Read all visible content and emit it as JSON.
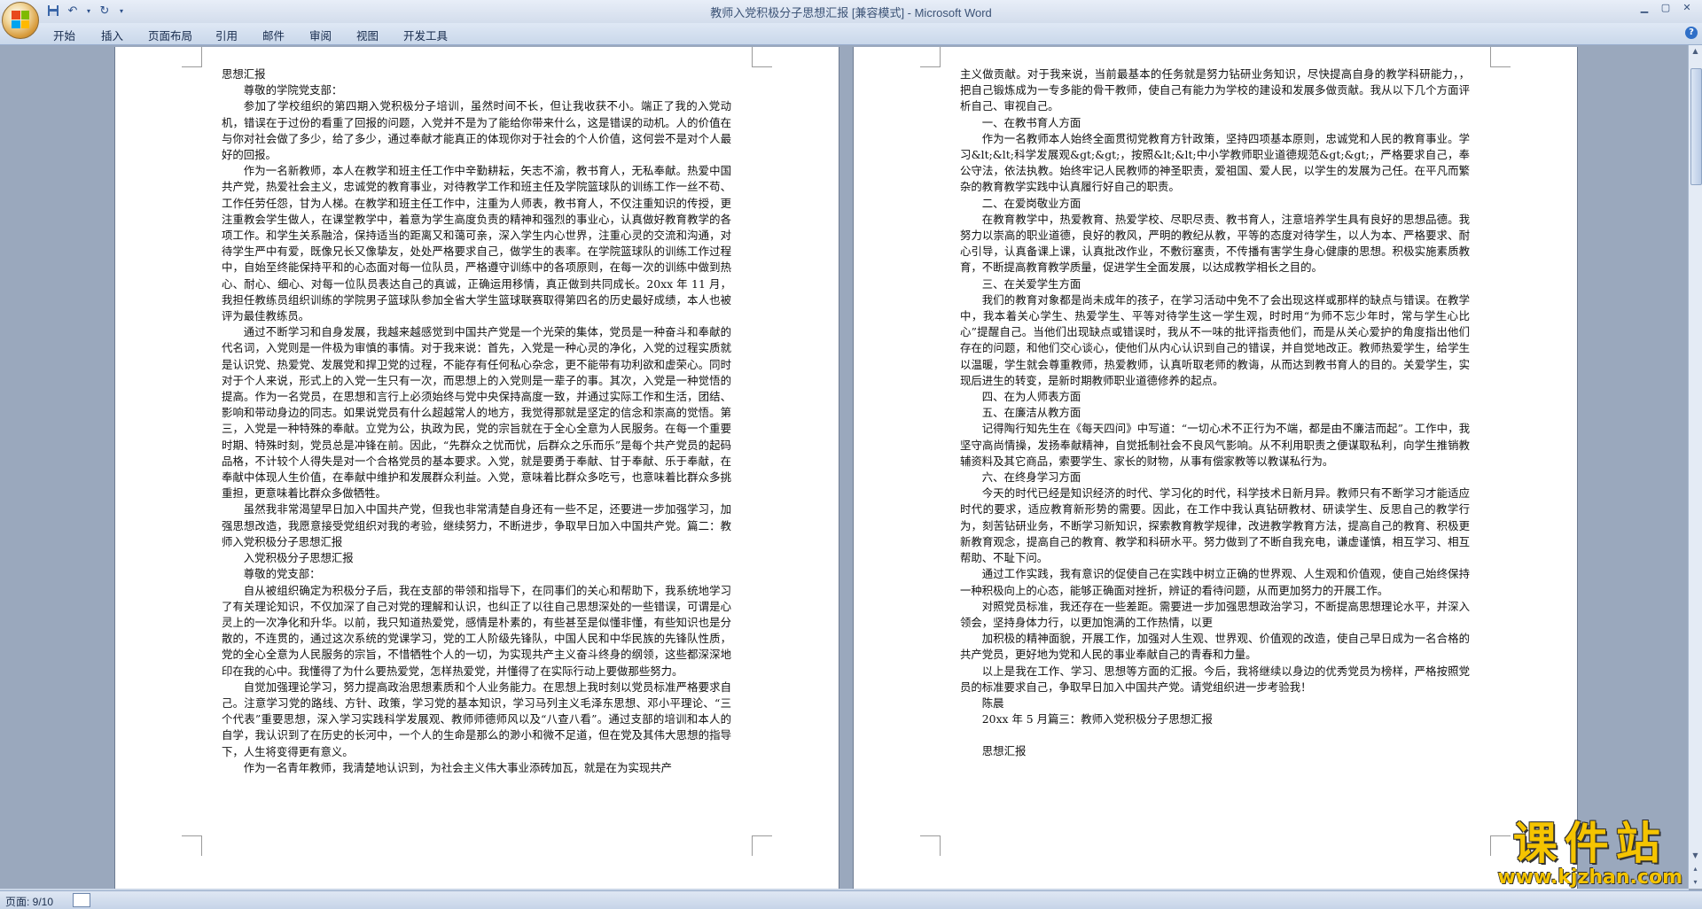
{
  "window": {
    "title": "教师入党积极分子思想汇报 [兼容模式] - Microsoft Word"
  },
  "quick_access": {
    "save_icon": "save-icon",
    "undo_icon": "undo-icon",
    "redo_icon": "redo-icon"
  },
  "ribbon": {
    "tabs": [
      {
        "label": "开始"
      },
      {
        "label": "插入"
      },
      {
        "label": "页面布局"
      },
      {
        "label": "引用"
      },
      {
        "label": "邮件"
      },
      {
        "label": "审阅"
      },
      {
        "label": "视图"
      },
      {
        "label": "开发工具"
      }
    ],
    "help": "?"
  },
  "page1": {
    "paragraphs": [
      {
        "text": "思想汇报",
        "indent": false
      },
      {
        "text": "尊敬的学院党支部：",
        "indent": true
      },
      {
        "text": "参加了学校组织的第四期入党积极分子培训，虽然时间不长，但让我收获不小。端正了我的入党动机，错误在于过份的看重了回报的问题，入党并不是为了能给你带来什么，这是错误的动机。人的价值在与你对社会做了多少，给了多少，通过奉献才能真正的体现你对于社会的个人价值，这何尝不是对个人最好的回报。",
        "indent": true
      },
      {
        "text": "作为一名新教师，本人在教学和班主任工作中辛勤耕耘，矢志不渝，教书育人，无私奉献。热爱中国共产党，热爱社会主义，忠诚党的教育事业，对待教学工作和班主任及学院篮球队的训练工作一丝不苟、工作任劳任怨，甘为人梯。在教学和班主任工作中，注重为人师表，教书育人，不仅注重知识的传授，更注重教会学生做人，在课堂教学中，着意为学生高度负责的精神和强烈的事业心，认真做好教育教学的各项工作。和学生关系融洽，保持适当的距离又和蔼可亲，深入学生内心世界，注重心灵的交流和沟通，对待学生严中有爱，既像兄长又像挚友，处处严格要求自己，做学生的表率。在学院篮球队的训练工作过程中，自始至终能保持平和的心态面对每一位队员，严格遵守训练中的各项原则，在每一次的训练中做到热心、耐心、细心、对每一位队员表达自己的真诚，正确运用移情，真正做到共同成长。20xx 年 11 月，我担任教练员组织训练的学院男子篮球队参加全省大学生篮球联赛取得第四名的历史最好成绩，本人也被评为最佳教练员。",
        "indent": true
      },
      {
        "text": "通过不断学习和自身发展，我越来越感觉到中国共产党是一个光荣的集体，党员是一种奋斗和奉献的代名词，入党则是一件极为审慎的事情。对于我来说：首先，入党是一种心灵的净化，入党的过程实质就是认识党、热爱党、发展党和捍卫党的过程，不能存有任何私心杂念，更不能带有功利欲和虚荣心。同时对于个人来说，形式上的入党一生只有一次，而思想上的入党则是一辈子的事。其次，入党是一种觉悟的提高。作为一名党员，在思想和言行上必须始终与党中央保持高度一致，并通过实际工作和生活，团结、影响和带动身边的同志。如果说党员有什么超越常人的地方，我觉得那就是坚定的信念和崇高的觉悟。第三，入党是一种特殊的奉献。立党为公，执政为民，党的宗旨就在于全心全意为人民服务。在每一个重要时期、特殊时刻，党员总是冲锋在前。因此，“先群众之忧而忧，后群众之乐而乐”是每个共产党员的起码品格，不计较个人得失是对一个合格党员的基本要求。入党，就是要勇于奉献、甘于奉献、乐于奉献，在奉献中体现人生价值，在奉献中维护和发展群众利益。入党，意味着比群众多吃亏，也意味着比群众多挑重担，更意味着比群众多做牺牲。",
        "indent": true
      },
      {
        "text": "虽然我非常渴望早日加入中国共产党，但我也非常清楚自身还有一些不足，还要进一步加强学习，加强思想改造，我愿意接受党组织对我的考验，继续努力，不断进步，争取早日加入中国共产党。篇二：教师入党积极分子思想汇报",
        "indent": true
      },
      {
        "text": "入党积极分子思想汇报",
        "indent": true
      },
      {
        "text": "尊敬的党支部：",
        "indent": true
      },
      {
        "text": "自从被组织确定为积极分子后，我在支部的带领和指导下，在同事们的关心和帮助下，我系统地学习了有关理论知识，不仅加深了自己对党的理解和认识，也纠正了以往自己思想深处的一些错误，可谓是心灵上的一次净化和升华。以前，我只知道热爱党，感情是朴素的，有些甚至是似懂非懂，有些知识也是分散的，不连贯的，通过这次系统的党课学习，党的工人阶级先锋队，中国人民和中华民族的先锋队性质，党的全心全意为人民服务的宗旨，不惜牺牲个人的一切，为实现共产主义奋斗终身的纲领，这些都深深地印在我的心中。我懂得了为什么要热爱党，怎样热爱党，并懂得了在实际行动上要做那些努力。",
        "indent": true
      },
      {
        "text": "自觉加强理论学习，努力提高政治思想素质和个人业务能力。在思想上我时刻以党员标准严格要求自己。注意学习党的路线、方针、政策，学习党的基本知识，学习马列主义毛泽东思想、邓小平理论、“三个代表”重要思想，深入学习实践科学发展观、教师师德师风以及“八查八看”。通过支部的培训和本人的自学，我认识到了在历史的长河中，一个人的生命是那么的渺小和微不足道，但在党及其伟大思想的指导下，人生将变得更有意义。",
        "indent": true
      },
      {
        "text": "作为一名青年教师，我清楚地认识到，为社会主义伟大事业添砖加瓦，就是在为实现共产",
        "indent": true
      }
    ]
  },
  "page2": {
    "paragraphs": [
      {
        "text": "主义做贡献。对于我来说，当前最基本的任务就是努力钻研业务知识，尽快提高自身的教学科研能力，，把自己锻炼成为一专多能的骨干教师，使自己有能力为学校的建设和发展多做贡献。我从以下几个方面评析自己、审视自己。",
        "indent": false
      },
      {
        "text": "一、在教书育人方面",
        "indent": true
      },
      {
        "text": "作为一名教师本人始终全面贯彻党教育方针政策，坚持四项基本原则，忠诚党和人民的教育事业。学习&lt;&lt;科学发展观&gt;&gt;，按照&lt;&lt;中小学教师职业道德规范&gt;&gt;，严格要求自己，奉公守法，依法执教。始终牢记人民教师的神圣职责，爱祖国、爱人民，以学生的发展为己任。在平凡而繁杂的教育教学实践中认真履行好自己的职责。",
        "indent": true
      },
      {
        "text": "二、在爱岗敬业方面",
        "indent": true
      },
      {
        "text": "在教育教学中，热爱教育、热爱学校、尽职尽责、教书育人，注意培养学生具有良好的思想品德。我努力以崇高的职业道德，良好的教风，严明的教纪从教，平等的态度对待学生，以人为本、严格要求、耐心引导，认真备课上课，认真批改作业，不敷衍塞责，不传播有害学生身心健康的思想。积极实施素质教育，不断提高教育教学质量，促进学生全面发展，以达成教学相长之目的。",
        "indent": true
      },
      {
        "text": "三、在关爱学生方面",
        "indent": true
      },
      {
        "text": "我们的教育对象都是尚未成年的孩子，在学习活动中免不了会出现这样或那样的缺点与错误。在教学中，我本着关心学生、热爱学生、平等对待学生这一学生观，时时用“为师不忘少年时，常与学生心比心”提醒自己。当他们出现缺点或错误时，我从不一味的批评指责他们，而是从关心爱护的角度指出他们存在的问题，和他们交心谈心，使他们从内心认识到自己的错误，并自觉地改正。教师热爱学生，给学生以温暖，学生就会尊重教师，热爱教师，认真听取老师的教诲，从而达到教书育人的目的。关爱学生，实现后进生的转变，是新时期教师职业道德修养的起点。",
        "indent": true
      },
      {
        "text": "四、在为人师表方面",
        "indent": true
      },
      {
        "text": "五、在廉洁从教方面",
        "indent": true
      },
      {
        "text": "记得陶行知先生在《每天四问》中写道：“一切心术不正行为不端，都是由不廉洁而起”。工作中，我坚守高尚情操，发扬奉献精神，自觉抵制社会不良风气影响。从不利用职责之便谋取私利，向学生推销教辅资料及其它商品，索要学生、家长的财物，从事有偿家教等以教谋私行为。",
        "indent": true
      },
      {
        "text": "六、在终身学习方面",
        "indent": true
      },
      {
        "text": "今天的时代已经是知识经济的时代、学习化的时代，科学技术日新月异。教师只有不断学习才能适应时代的要求，适应教育新形势的需要。因此，在工作中我认真钻研教材、研读学生、反思自己的教学行为，刻苦钻研业务，不断学习新知识，探索教育教学规律，改进教学教育方法，提高自己的教育、积极更新教育观念，提高自己的教育、教学和科研水平。努力做到了不断自我充电，谦虚谨慎，相互学习、相互帮助、不耻下问。",
        "indent": true
      },
      {
        "text": "通过工作实践，我有意识的促使自己在实践中树立正确的世界观、人生观和价值观，使自己始终保持一种积极向上的心态，能够正确面对挫折，辨证的看待问题，从而更加努力的开展工作。",
        "indent": true
      },
      {
        "text": "对照党员标准，我还存在一些差距。需要进一步加强思想政治学习，不断提高思想理论水平，并深入领会，坚持身体力行，以更加饱满的工作热情，以更",
        "indent": true
      },
      {
        "text": "加积极的精神面貌，开展工作，加强对人生观、世界观、价值观的改造，使自己早日成为一名合格的共产党员，更好地为党和人民的事业奉献自己的青春和力量。",
        "indent": true
      },
      {
        "text": "以上是我在工作、学习、思想等方面的汇报。今后，我将继续以身边的优秀党员为榜样，严格按照党员的标准要求自己，争取早日加入中国共产党。请党组织进一步考验我！",
        "indent": true
      },
      {
        "text": "陈晨",
        "indent": true
      },
      {
        "text": "20xx 年 5 月篇三：教师入党积极分子思想汇报",
        "indent": true
      },
      {
        "text": "",
        "indent": true
      },
      {
        "text": "思想汇报",
        "indent": true
      }
    ]
  },
  "status": {
    "page": "页面: 9/10"
  },
  "watermark": {
    "title": "课件站",
    "url": "www.kjzhan.com"
  },
  "colors": {
    "ribbon": "#d3ddec",
    "doc_bg": "#9aa8bd",
    "accent": "#2b4f8a",
    "watermark": "#f5c400"
  }
}
